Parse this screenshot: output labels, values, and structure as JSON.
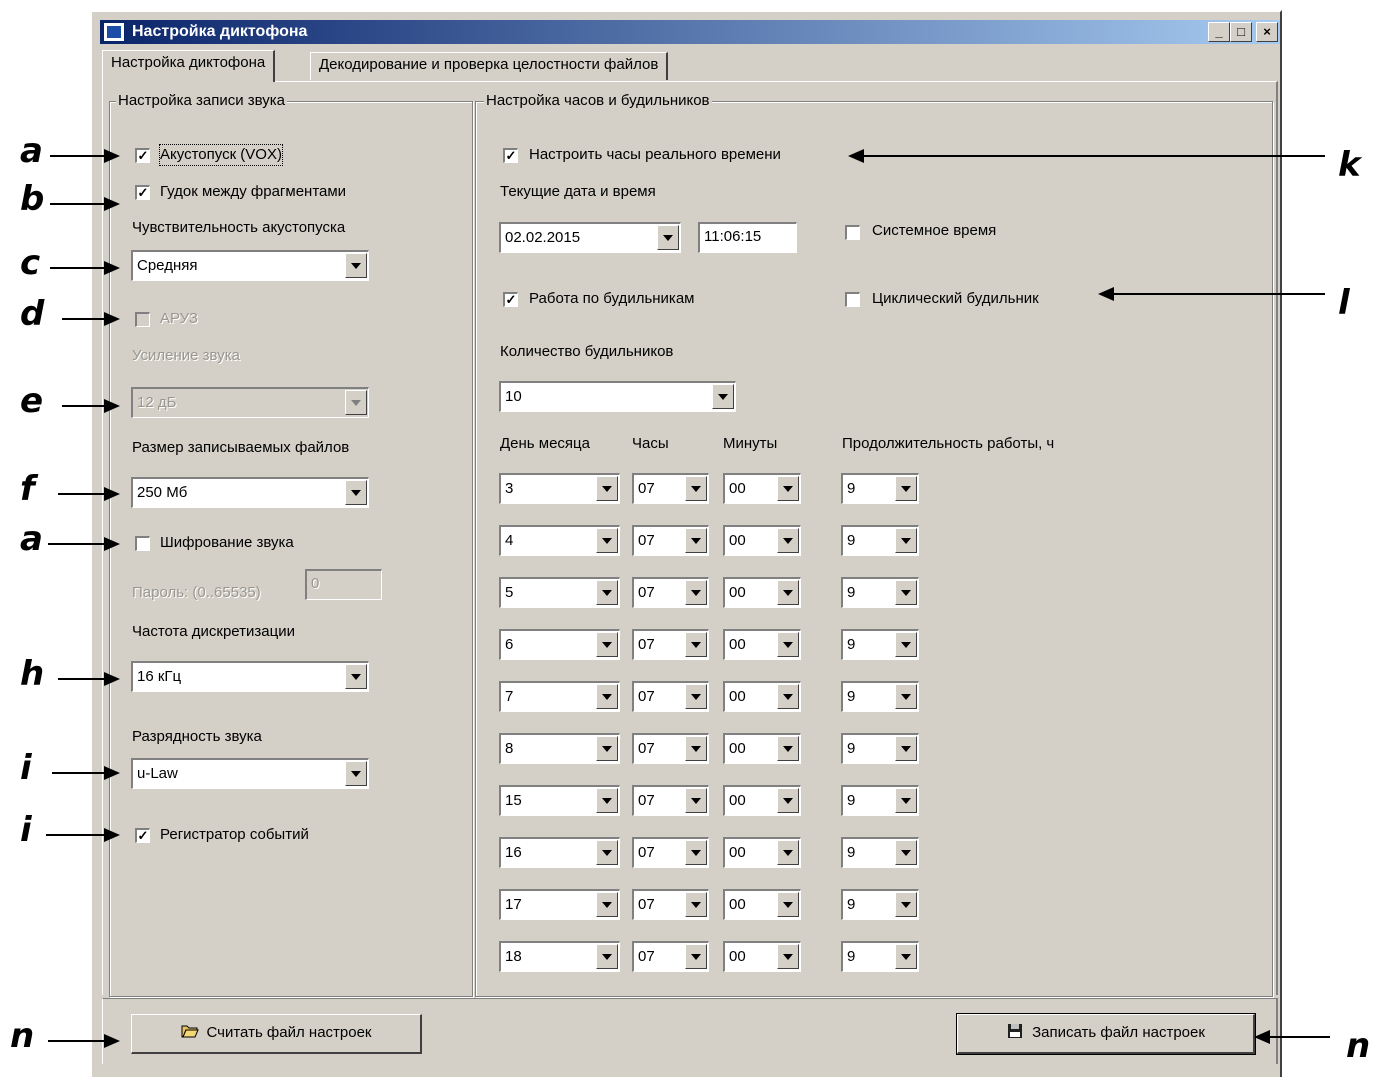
{
  "window": {
    "title": "Настройка диктофона",
    "minimize": "_",
    "maximize": "□",
    "close": "×"
  },
  "tabs": [
    {
      "label": "Настройка диктофона",
      "active": true
    },
    {
      "label": "Декодирование и проверка целостности файлов",
      "active": false
    }
  ],
  "recording": {
    "group_title": "Настройка записи звука",
    "vox": {
      "label": "Акустопуск (VOX)",
      "checked": true
    },
    "beep": {
      "label": "Гудок между фрагментами",
      "checked": true
    },
    "sensitivity_label": "Чувствительность акустопуска",
    "sensitivity_value": "Средняя",
    "agc": {
      "label": "АРУЗ",
      "checked": false
    },
    "gain_label": "Усиление звука",
    "gain_value": "12 дБ",
    "filesize_label": "Размер записываемых файлов",
    "filesize_value": "250 Мб",
    "encryption": {
      "label": "Шифрование звука",
      "checked": false
    },
    "password_label": "Пароль: (0..65535)",
    "password_value": "0",
    "samplerate_label": "Частота дискретизации",
    "samplerate_value": "16 кГц",
    "bitdepth_label": "Разрядность звука",
    "bitdepth_value": "u-Law",
    "eventlog": {
      "label": "Регистратор событий",
      "checked": true
    }
  },
  "clock": {
    "group_title": "Настройка часов и будильников",
    "rtc": {
      "label": "Настроить часы реального времени",
      "checked": true
    },
    "datetime_label": "Текущие дата и время",
    "date_value": "02.02.2015",
    "time_value": "11:06:15",
    "system_time": {
      "label": "Системное время",
      "checked": false
    },
    "alarm_mode": {
      "label": "Работа по будильникам",
      "checked": true
    },
    "cyclic": {
      "label": "Циклический будильник",
      "checked": false
    },
    "alarm_count_label": "Количество будильников",
    "alarm_count_value": "10",
    "columns": {
      "day": "День месяца",
      "hours": "Часы",
      "minutes": "Минуты",
      "duration": "Продолжительность работы, ч"
    },
    "alarms": [
      {
        "day": "3",
        "hours": "07",
        "minutes": "00",
        "duration": "9"
      },
      {
        "day": "4",
        "hours": "07",
        "minutes": "00",
        "duration": "9"
      },
      {
        "day": "5",
        "hours": "07",
        "minutes": "00",
        "duration": "9"
      },
      {
        "day": "6",
        "hours": "07",
        "minutes": "00",
        "duration": "9"
      },
      {
        "day": "7",
        "hours": "07",
        "minutes": "00",
        "duration": "9"
      },
      {
        "day": "8",
        "hours": "07",
        "minutes": "00",
        "duration": "9"
      },
      {
        "day": "15",
        "hours": "07",
        "minutes": "00",
        "duration": "9"
      },
      {
        "day": "16",
        "hours": "07",
        "minutes": "00",
        "duration": "9"
      },
      {
        "day": "17",
        "hours": "07",
        "minutes": "00",
        "duration": "9"
      },
      {
        "day": "18",
        "hours": "07",
        "minutes": "00",
        "duration": "9"
      }
    ]
  },
  "buttons": {
    "read": "Считать файл настроек",
    "write": "Записать файл настроек"
  },
  "annotations": {
    "left": [
      "a",
      "b",
      "c",
      "d",
      "e",
      "f",
      "a",
      "h",
      "i",
      "i",
      "n"
    ],
    "right": [
      "k",
      "l",
      "n"
    ]
  }
}
